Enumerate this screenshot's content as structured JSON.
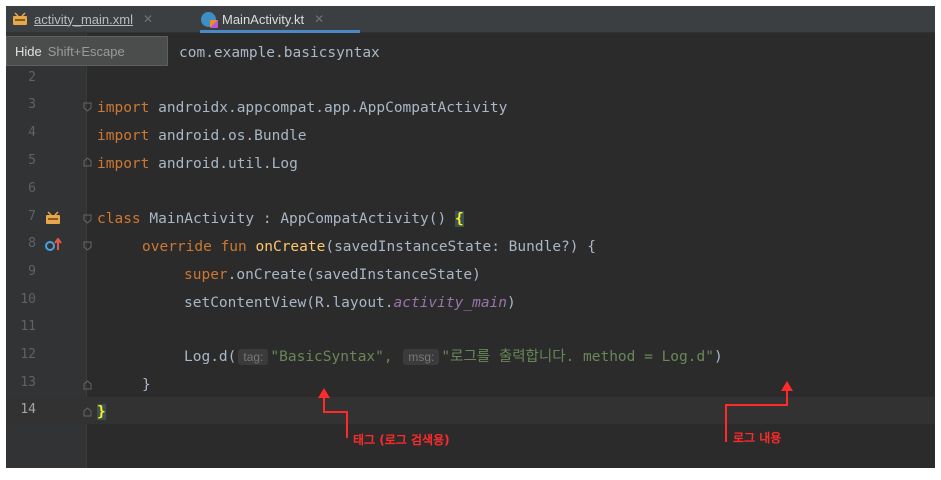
{
  "tabs": [
    {
      "label": "activity_main.xml",
      "icon": "xml-file-icon",
      "active": false
    },
    {
      "label": "MainActivity.kt",
      "icon": "kotlin-file-icon",
      "active": true
    }
  ],
  "popup": {
    "hide_label": "Hide",
    "shortcut": "Shift+Escape"
  },
  "line_numbers": [
    "2",
    "3",
    "4",
    "5",
    "6",
    "7",
    "8",
    "9",
    "10",
    "11",
    "12",
    "13",
    "14"
  ],
  "code": {
    "pkg": "com.example.basicsyntax",
    "import_kw": "import",
    "import1_path": " androidx.appcompat.app.AppCompatActivity",
    "import2_path": " android.os.Bundle",
    "import3_path": " android.util.Log",
    "class_kw": "class",
    "class_decl": " MainActivity : AppCompatActivity() ",
    "open_brace": "{",
    "override_kw": "override fun",
    "oncreate_fn": "onCreate",
    "oncreate_params": "(savedInstanceState: Bundle?) {",
    "super_kw": "super",
    "super_call": ".onCreate(savedInstanceState)",
    "setcontent_call": "setContentView(R.layout.",
    "layout_name": "activity_main",
    "setcontent_close": ")",
    "log_call": "Log.d(",
    "tag_hint": "tag:",
    "tag_value": "\"BasicSyntax\",",
    "msg_hint": "msg:",
    "msg_value": "\"로그를 출력합니다. method = Log.d\"",
    "log_close": ")",
    "close_inner": "}",
    "close_outer": "}"
  },
  "annotations": {
    "tag_label": "태그 (로그 검색용)",
    "content_label": "로그 내용"
  },
  "colors": {
    "keyword": "#cc7832",
    "function": "#ffc66d",
    "string": "#6a8759",
    "annotation": "#ff2a2a"
  }
}
